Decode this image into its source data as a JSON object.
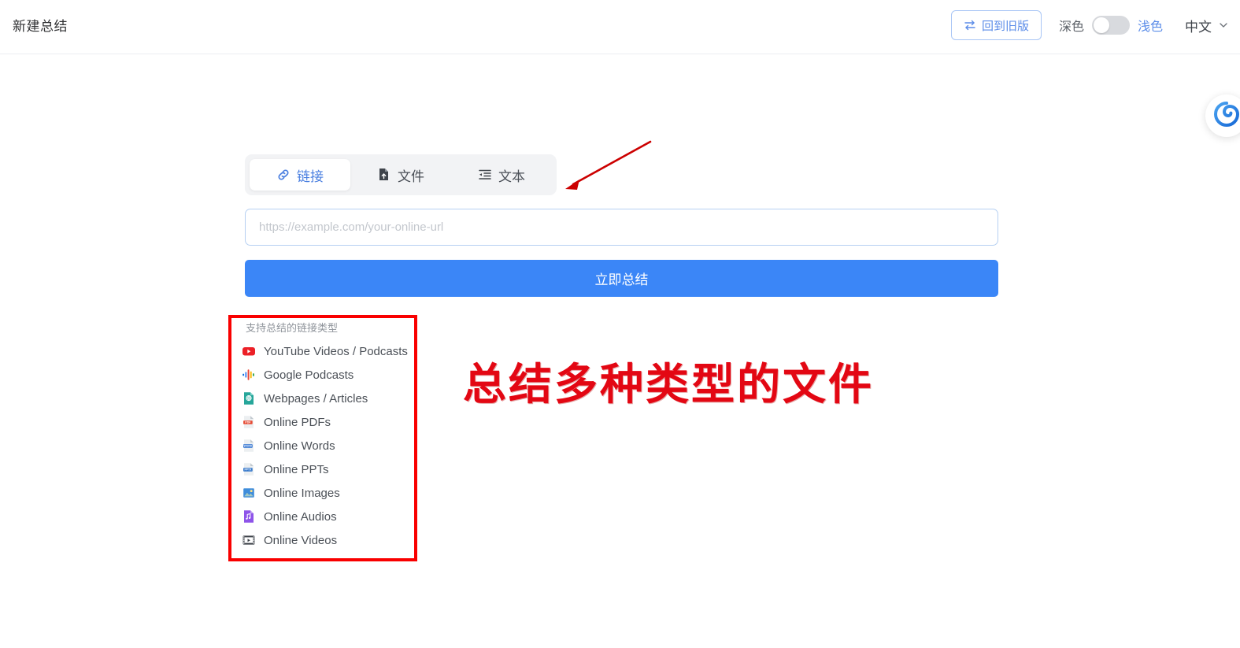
{
  "header": {
    "title": "新建总结",
    "legacy_button": {
      "label": "回到旧版",
      "icon": "swap-icon"
    },
    "theme": {
      "dark_label": "深色",
      "light_label": "浅色",
      "toggle_state": "light",
      "accent_color": "#5b8ce8"
    },
    "language": {
      "label": "中文",
      "icon": "chevron-down-icon"
    }
  },
  "form": {
    "tabs": [
      {
        "label": "链接",
        "icon": "link-icon",
        "active": true
      },
      {
        "label": "文件",
        "icon": "file-upload-icon",
        "active": false
      },
      {
        "label": "文本",
        "icon": "text-align-icon",
        "active": false
      }
    ],
    "url_input": {
      "value": "",
      "placeholder": "https://example.com/your-online-url"
    },
    "submit_label": "立即总结",
    "primary_color": "#3b86f7"
  },
  "supported_types": {
    "title": "支持总结的链接类型",
    "items": [
      {
        "label": "YouTube Videos / Podcasts",
        "icon": "youtube-icon"
      },
      {
        "label": "Google Podcasts",
        "icon": "google-podcasts-icon"
      },
      {
        "label": "Webpages / Articles",
        "icon": "webpage-icon"
      },
      {
        "label": "Online PDFs",
        "icon": "pdf-file-icon"
      },
      {
        "label": "Online Words",
        "icon": "word-file-icon"
      },
      {
        "label": "Online PPTs",
        "icon": "pptx-file-icon"
      },
      {
        "label": "Online Images",
        "icon": "image-file-icon"
      },
      {
        "label": "Online Audios",
        "icon": "audio-file-icon"
      },
      {
        "label": "Online Videos",
        "icon": "video-file-icon"
      }
    ]
  },
  "annotations": {
    "callout_text": "总结多种类型的文件",
    "callout_color": "#e30713",
    "box_color": "#f90000",
    "arrow_color": "#cc0000"
  },
  "float_widget": {
    "icon": "spiral-icon"
  }
}
